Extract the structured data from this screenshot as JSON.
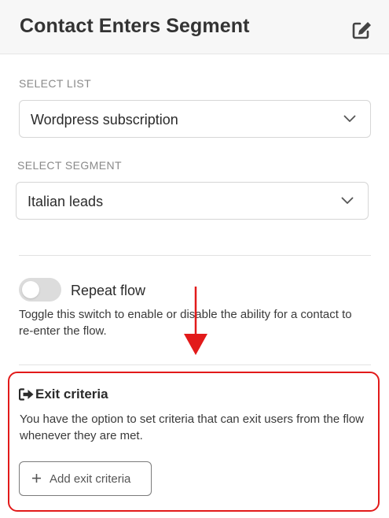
{
  "header": {
    "title": "Contact Enters Segment",
    "edit_icon": "edit-icon"
  },
  "list": {
    "label": "SELECT LIST",
    "value": "Wordpress subscription",
    "icon": "chevron-down-icon"
  },
  "segment": {
    "label": "SELECT SEGMENT",
    "value": "Italian leads",
    "icon": "chevron-down-icon"
  },
  "repeat": {
    "label": "Repeat flow",
    "enabled": false,
    "description": "Toggle this switch to enable or disable the ability for a contact to re-enter the flow."
  },
  "exit": {
    "icon": "sign-out-icon",
    "title": "Exit criteria",
    "description": "You have the option to set criteria that can exit users from the flow whenever they are met.",
    "button_label": "Add exit criteria",
    "button_icon": "plus-icon"
  },
  "colors": {
    "highlight": "#e21a1a",
    "toggle_off": "#dcdcdc",
    "header_bg": "#f7f7f7"
  }
}
